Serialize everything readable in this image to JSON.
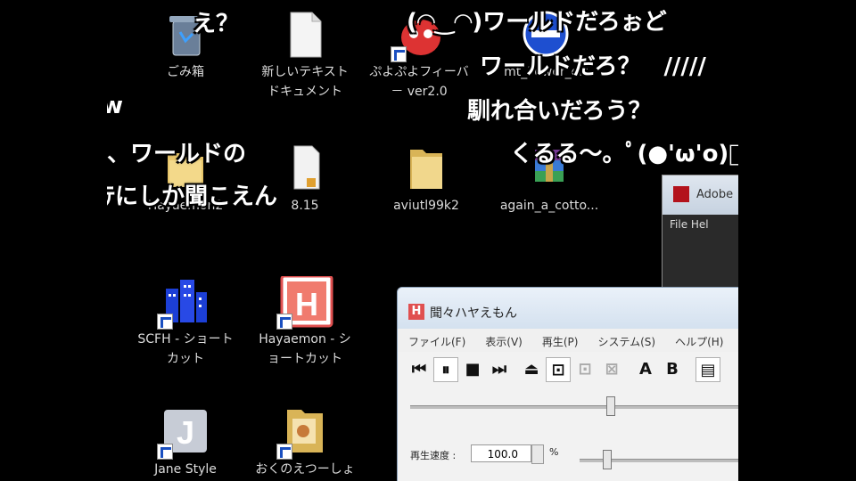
{
  "desktop": {
    "icons": [
      {
        "name": "recycle-bin-icon",
        "label": "ごみ箱"
      },
      {
        "name": "text-document-icon",
        "label": "新しいテキスト\nドキュメント"
      },
      {
        "name": "puyo-icon",
        "label": "ぷよぷよフィーバ\n－ ver2.0"
      },
      {
        "name": "power-off-icon",
        "label": "mt_Power_off"
      },
      {
        "name": "folder-icon",
        "label": "Hayaemon2"
      },
      {
        "name": "text-file-icon",
        "label": "8.15"
      },
      {
        "name": "folder-icon",
        "label": "aviutl99k2"
      },
      {
        "name": "archive-icon",
        "label": "again_a_cotto..."
      },
      {
        "name": "scfh-icon",
        "label": "SCFH - ショート\nカット"
      },
      {
        "name": "hayaemon-icon",
        "label": "Hayaemon - シ\nョートカット"
      },
      {
        "name": "jane-style-icon",
        "label": "Jane Style"
      },
      {
        "name": "folder-shortcut-icon",
        "label": "おくのえつーしょ"
      }
    ]
  },
  "comments": [
    "え？",
    "(◠‿◠)ワールドだろぉど",
    "ワールドだろ？　/////",
    "馴れ合いだろう？",
    "、ワールドの",
    "くるる～。ﾟ(●'ω'o)ﾟ",
    "ﾃにしか聞こえん",
    "w"
  ],
  "adobe_window": {
    "title": "Adobe",
    "menu": "File   Hel"
  },
  "hayaemon_window": {
    "title": "聞々ハヤえもん",
    "menus": [
      "ファイル(F)",
      "表示(V)",
      "再生(P)",
      "システム(S)",
      "ヘルプ(H)"
    ],
    "toolbar": [
      "⏮",
      "⏸",
      "■",
      "⏭",
      "⏏",
      "⊡",
      "⊡",
      "⊠",
      "A",
      "B",
      "▤"
    ],
    "speed_label": "再生速度 :",
    "speed_value": "100.0",
    "speed_unit": "%",
    "app_icon_letter": "H"
  },
  "colors": {
    "background": "#000000",
    "comment": "#ffffff",
    "title_bar": "#dbe6f2"
  }
}
